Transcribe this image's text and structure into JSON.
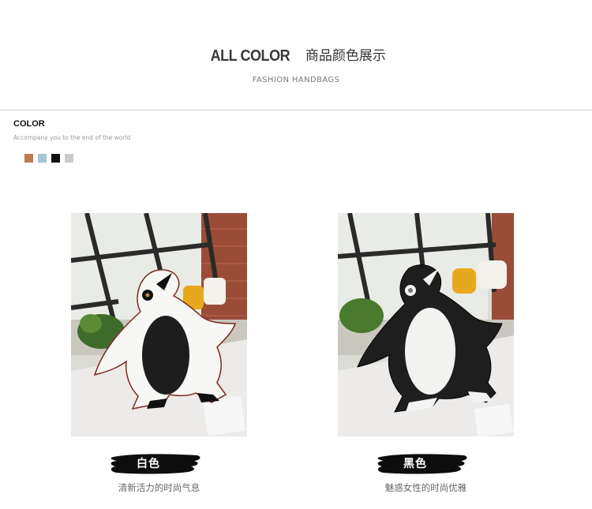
{
  "header": {
    "title_en": "ALL COLOR",
    "title_cn": "商品颜色展示",
    "subtitle": "FASHION HANDBAGS"
  },
  "color_section": {
    "label": "COLOR",
    "description": "Accompany you to the end of the world",
    "swatches": [
      "#c27a52",
      "#a4c4d4",
      "#111111",
      "#cbcbcb"
    ]
  },
  "products": [
    {
      "color_name": "白色",
      "caption": "清新活力的时尚气息",
      "bag_color": "#f7f7f5",
      "belly_color": "#1d1d1d"
    },
    {
      "color_name": "黑色",
      "caption": "魅惑女性的时尚优雅",
      "bag_color": "#1e1e1e",
      "belly_color": "#f2f2f0"
    }
  ]
}
